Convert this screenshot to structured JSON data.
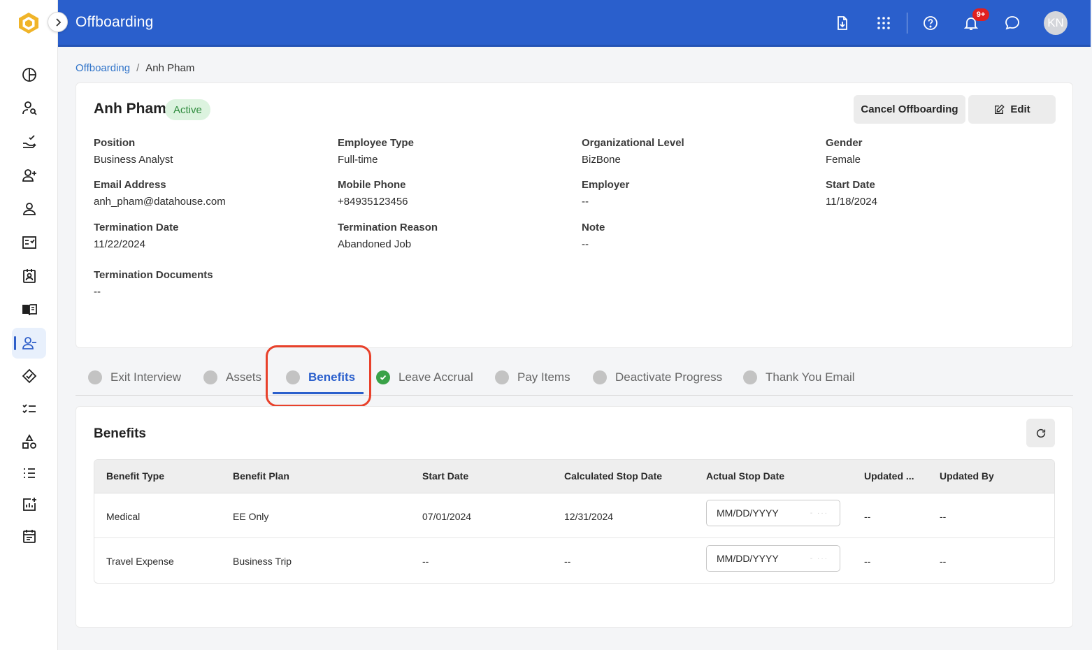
{
  "app": {
    "title": "Offboarding",
    "notification_count": "9+",
    "user_initials": "KN"
  },
  "breadcrumb": {
    "root": "Offboarding",
    "separator": "/",
    "current": "Anh Pham"
  },
  "employee": {
    "name": "Anh Pham",
    "status": "Active",
    "actions": {
      "cancel_label": "Cancel Offboarding",
      "edit_label": "Edit"
    },
    "fields": [
      {
        "label": "Position",
        "value": "Business Analyst"
      },
      {
        "label": "Employee Type",
        "value": "Full-time"
      },
      {
        "label": "Organizational Level",
        "value": "BizBone"
      },
      {
        "label": "Gender",
        "value": "Female"
      },
      {
        "label": "Email Address",
        "value": "anh_pham@datahouse.com"
      },
      {
        "label": "Mobile Phone",
        "value": "+84935123456"
      },
      {
        "label": "Employer",
        "value": "--"
      },
      {
        "label": "Start Date",
        "value": "11/18/2024"
      },
      {
        "label": "Termination Date",
        "value": "11/22/2024"
      },
      {
        "label": "Termination Reason",
        "value": "Abandoned Job"
      },
      {
        "label": "Note",
        "value": "--"
      },
      {
        "label": "Termination Documents",
        "value": "--"
      }
    ]
  },
  "tabs": [
    {
      "label": "Exit Interview",
      "state": "pending"
    },
    {
      "label": "Assets",
      "state": "pending"
    },
    {
      "label": "Benefits",
      "state": "active"
    },
    {
      "label": "Leave Accrual",
      "state": "completed"
    },
    {
      "label": "Pay Items",
      "state": "pending"
    },
    {
      "label": "Deactivate Progress",
      "state": "pending"
    },
    {
      "label": "Thank You Email",
      "state": "pending"
    }
  ],
  "benefits": {
    "title": "Benefits",
    "columns": [
      "Benefit Type",
      "Benefit Plan",
      "Start Date",
      "Calculated Stop Date",
      "Actual Stop Date",
      "Updated ...",
      "Updated By"
    ],
    "rows": [
      {
        "type": "Medical",
        "plan": "EE Only",
        "start": "07/01/2024",
        "calc_stop": "12/31/2024",
        "actual_stop_placeholder": "MM/DD/YYYY",
        "updated": "--",
        "updated_by": "--"
      },
      {
        "type": "Travel Expense",
        "plan": "Business Trip",
        "start": "--",
        "calc_stop": "--",
        "actual_stop_placeholder": "MM/DD/YYYY",
        "updated": "--",
        "updated_by": "--"
      }
    ]
  },
  "colors": {
    "header": "#2a5fcc",
    "accent": "#2a5fcc",
    "status_active_bg": "#dcf3df",
    "status_active_text": "#2e8b3d",
    "highlight": "#e8412b",
    "completed": "#3aa248"
  },
  "sidebar_icons": [
    "dashboard-icon",
    "user-search-icon",
    "hand-check-icon",
    "user-add-icon",
    "user-icon",
    "checklist-icon",
    "badge-icon",
    "handbook-icon",
    "user-minus-icon",
    "handshake-icon",
    "task-list-icon",
    "shapes-icon",
    "list-icon",
    "report-add-icon",
    "calendar-icon"
  ]
}
